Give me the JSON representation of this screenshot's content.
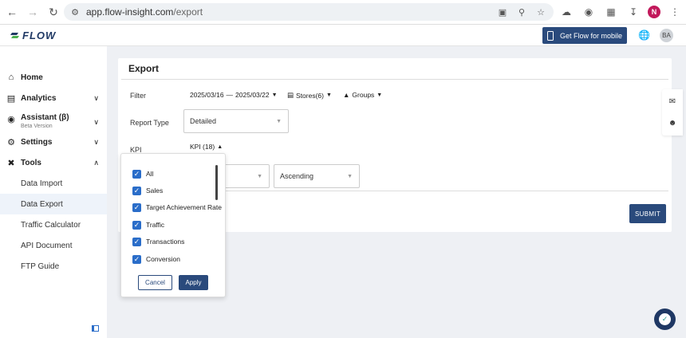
{
  "browser": {
    "url_host": "app.flow-insight.com",
    "url_path": "/export",
    "profile_initial": "N"
  },
  "header": {
    "logo_text": "FLOW",
    "mobile_button": "Get Flow for mobile",
    "avatar": "BA"
  },
  "sidebar": {
    "home": "Home",
    "analytics": "Analytics",
    "assistant": "Assistant (β)",
    "assistant_sub": "Beta Version",
    "settings": "Settings",
    "tools": "Tools",
    "tools_items": [
      "Data Import",
      "Data Export",
      "Traffic Calculator",
      "API Document",
      "FTP Guide"
    ]
  },
  "export": {
    "title": "Export",
    "filter_label": "Filter",
    "date_start": "2025/03/16",
    "date_sep": "—",
    "date_end": "2025/03/22",
    "stores": "Stores(6)",
    "groups": "Groups",
    "report_type_label": "Report Type",
    "report_type_value": "Detailed",
    "kpi_label": "KPI",
    "kpi_trigger": "KPI (18)",
    "sort_value": "Ascending",
    "submit": "SUBMIT"
  },
  "kpi_panel": {
    "options": [
      "All",
      "Sales",
      "Target Achievement Rate",
      "Traffic",
      "Transactions",
      "Conversion"
    ],
    "cancel": "Cancel",
    "apply": "Apply"
  }
}
